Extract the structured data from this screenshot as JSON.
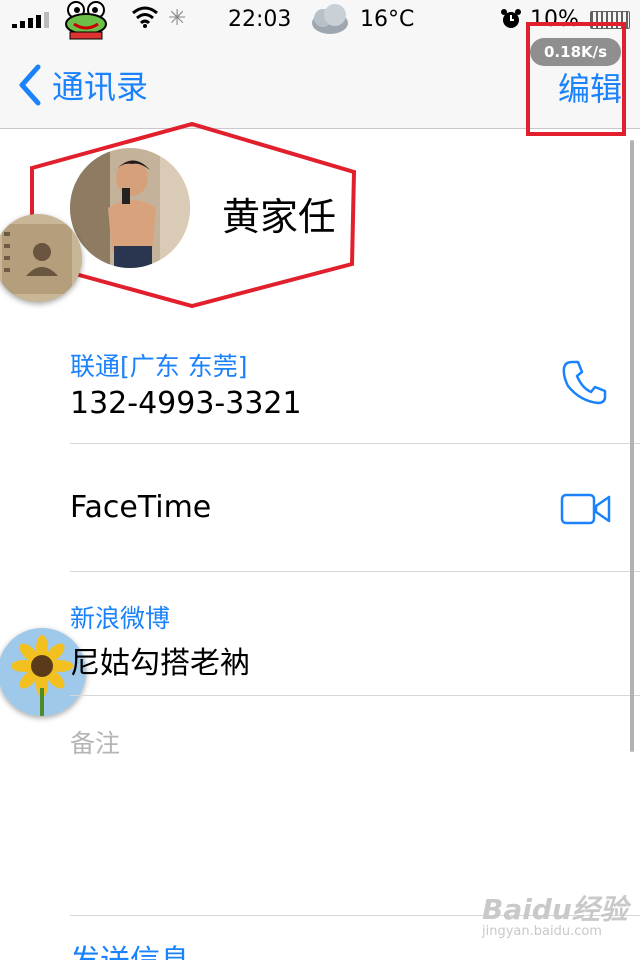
{
  "status_bar": {
    "time": "22:03",
    "temperature": "16°C",
    "battery_percent": "10%",
    "network_speed": "0.18K/s"
  },
  "nav": {
    "back_label": "通讯录",
    "edit_label": "编辑"
  },
  "contact": {
    "name": "黄家任"
  },
  "fields": {
    "phone": {
      "label": "联通[广东 东莞]",
      "value": "132-4993-3321"
    },
    "facetime": {
      "value": "FaceTime"
    },
    "weibo": {
      "label": "新浪微博",
      "value": "尼姑勾搭老衲"
    },
    "notes_placeholder": "备注",
    "send_message": "发送信息"
  },
  "watermark": {
    "brand": "Baidu经验",
    "url": "jingyan.baidu.com"
  },
  "colors": {
    "accent": "#1a82fb",
    "annotation": "#e21f2c"
  }
}
